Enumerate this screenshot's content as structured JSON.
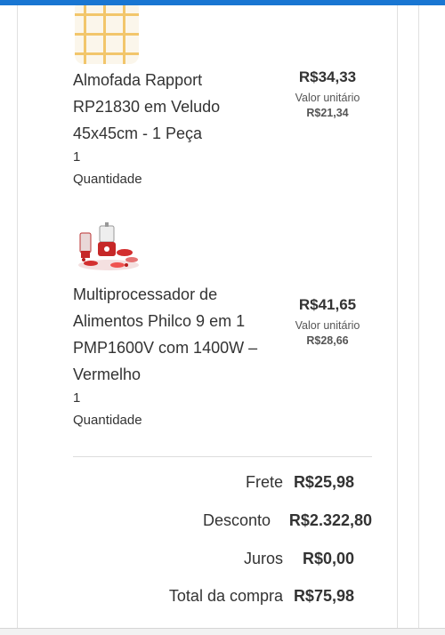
{
  "items": [
    {
      "name_lines": [
        "Almofada Rapport",
        "RP21830 em Veludo",
        "45x45cm - 1 Peça"
      ],
      "image_icon": "cushion-image",
      "quantity": "1",
      "quantity_label": "Quantidade",
      "price": "R$34,33",
      "unit_label": "Valor unitário",
      "unit_price": "R$21,34"
    },
    {
      "name_lines": [
        "Multiprocessador de",
        "Alimentos Philco 9 em 1",
        "PMP1600V com 1400W –",
        "Vermelho"
      ],
      "image_icon": "food-processor-image",
      "quantity": "1",
      "quantity_label": "Quantidade",
      "price": "R$41,65",
      "unit_label": "Valor unitário",
      "unit_price": "R$28,66"
    }
  ],
  "summary": {
    "shipping_label": "Frete",
    "shipping_value": "R$25,98",
    "discount_label": "Desconto",
    "discount_value": "R$2.322,80",
    "interest_label": "Juros",
    "interest_value": "R$0,00",
    "total_label": "Total da compra",
    "total_value": "R$75,98"
  },
  "colors": {
    "top_bar": "#1976d2",
    "text": "#333333",
    "product_red": "#c62828"
  }
}
